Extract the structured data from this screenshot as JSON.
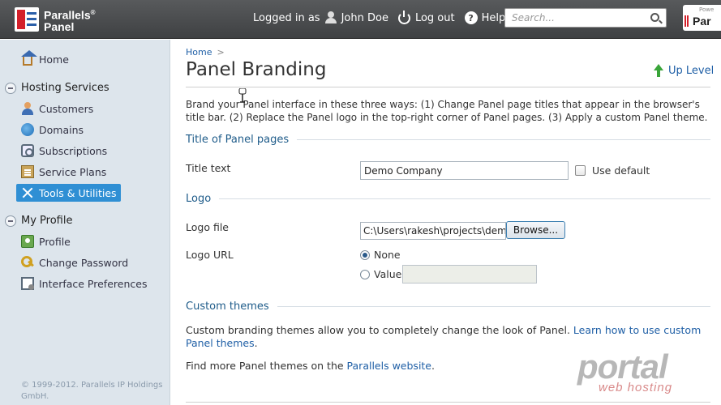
{
  "brand": {
    "line1": "Parallels",
    "line2": "Panel",
    "reg": "®"
  },
  "header": {
    "logged_in_as": "Logged in as",
    "user_name": "John Doe",
    "logout": "Log out",
    "help": "Help",
    "help_glyph": "?",
    "search_placeholder": "Search...",
    "powered_small": "Powe",
    "powered_big": "Par"
  },
  "sidebar": {
    "home": "Home",
    "hosting_services": {
      "title": "Hosting Services",
      "items": [
        "Customers",
        "Domains",
        "Subscriptions",
        "Service Plans",
        "Tools & Utilities"
      ]
    },
    "my_profile": {
      "title": "My Profile",
      "items": [
        "Profile",
        "Change Password",
        "Interface Preferences"
      ]
    },
    "active_item": "Tools & Utilities",
    "copyright": "© 1999-2012. Parallels IP Holdings GmbH."
  },
  "main": {
    "breadcrumb": {
      "home": "Home",
      "separator": ">"
    },
    "title": "Panel Branding",
    "up_level": "Up Level",
    "intro": "Brand your Panel interface in these three ways: (1) Change Panel page titles that appear in the browser's title bar. (2) Replace the Panel logo in the top-right corner of Panel pages. (3) Apply a custom Panel theme.",
    "sections": {
      "title_section": "Title of Panel pages",
      "logo_section": "Logo",
      "themes_section": "Custom themes"
    },
    "title_text_label": "Title text",
    "title_text_value": "Demo Company",
    "use_default_label": "Use default",
    "logo_file_label": "Logo file",
    "logo_file_value": "C:\\Users\\rakesh\\projects\\demo",
    "browse_label": "Browse...",
    "logo_url_label": "Logo URL",
    "radio_none": "None",
    "radio_value": "Value",
    "themes_text": "Custom branding themes allow you to completely change the look of Panel.",
    "themes_link": "Learn how to use custom Panel themes",
    "themes_link_end": ".",
    "find_more_text": "Find more Panel themes on the",
    "find_more_link": "Parallels website",
    "find_more_end": "."
  },
  "watermark": {
    "big": "portal",
    "small": "web hosting"
  },
  "colors": {
    "topbar": "#4a4c4e",
    "sidebar_bg": "#dde5ec",
    "active_nav": "#2f8fd4",
    "link": "#1f5fa6",
    "section_heading": "#1f5c8a"
  },
  "icons": {
    "search": "search-icon",
    "user": "user-icon",
    "logout": "power-icon",
    "help": "help-icon",
    "home": "home-icon",
    "customers": "user-icon",
    "domains": "globe-icon",
    "subscriptions": "subscription-icon",
    "service_plans": "plan-icon",
    "tools": "tools-icon",
    "profile": "profile-icon",
    "change_password": "key-icon",
    "interface_preferences": "preferences-icon",
    "up_level": "up-arrow-icon"
  },
  "form_state": {
    "use_default_checked": false,
    "logo_url_selected": "None"
  }
}
